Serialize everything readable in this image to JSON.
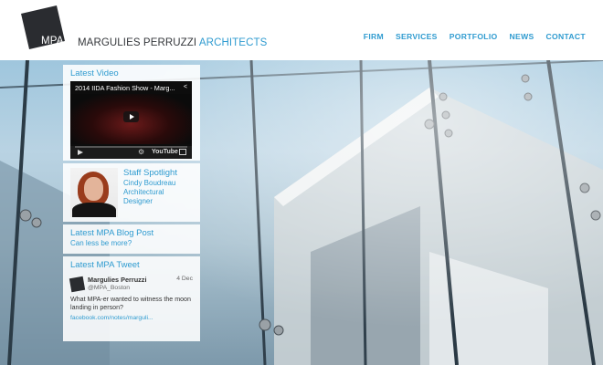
{
  "header": {
    "logo_mark": "MPA",
    "logo_name": "MARGULIES PERRUZZI",
    "logo_suffix": "ARCHITECTS",
    "nav": [
      "FIRM",
      "SERVICES",
      "PORTFOLIO",
      "NEWS",
      "CONTACT"
    ]
  },
  "video": {
    "section_title": "Latest Video",
    "title": "2014 IIDA Fashion Show - Marg...",
    "player_brand": "YouTube"
  },
  "staff": {
    "heading": "Staff Spotlight",
    "name": "Cindy Boudreau Architectural Designer"
  },
  "blog": {
    "heading": "Latest MPA Blog Post",
    "link_text": "Can less be more?"
  },
  "tweet": {
    "heading": "Latest MPA Tweet",
    "author": "Margulies Perruzzi",
    "handle": "@MPA_Boston",
    "date": "4 Dec",
    "body": "What MPA-er wanted to witness the moon landing in person?",
    "link": "facebook.com/notes/marguli..."
  },
  "colors": {
    "accent": "#2f9bd0",
    "logo_dark": "#2a2c30"
  }
}
